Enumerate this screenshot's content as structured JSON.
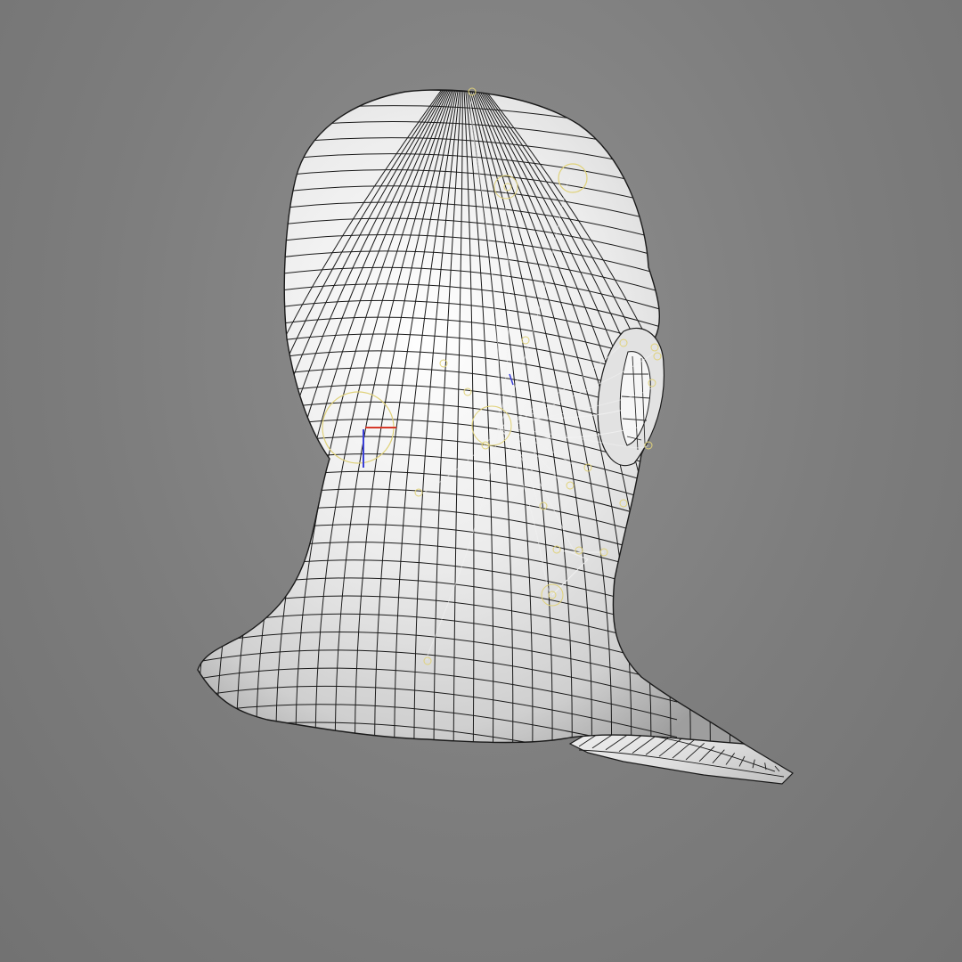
{
  "viewport": {
    "background_color": "#7e7e7e"
  },
  "model": {
    "subject": "head-and-shoulders-bust",
    "view": "back-left-three-quarter",
    "shading": "smooth-gray-with-wireframe",
    "surface_color": "#e9e9e9",
    "wire_color": "#1a1a1a"
  },
  "rig_overlay": {
    "joint_color": "#e0d27a",
    "link_color": "#f2f2f2",
    "axis_colors": {
      "x": "#d63a2a",
      "y": "#3a3fd6"
    }
  }
}
